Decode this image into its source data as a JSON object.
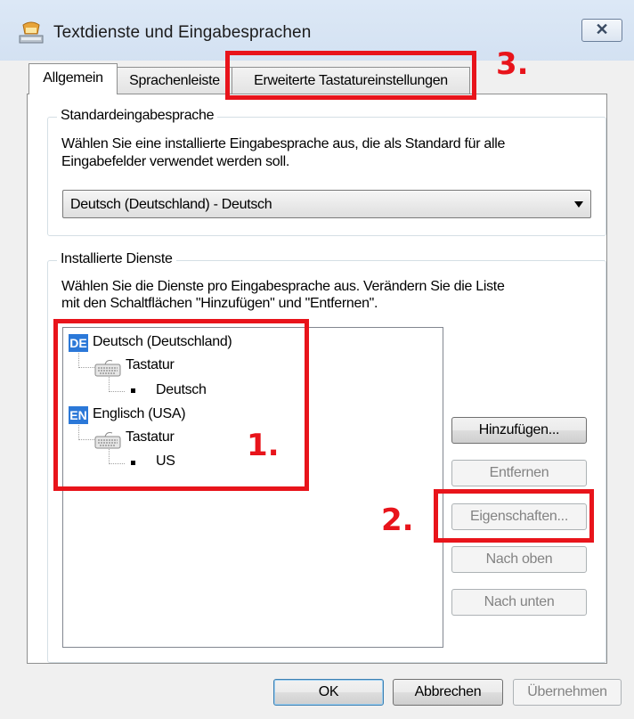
{
  "window": {
    "title": "Textdienste und Eingabesprachen",
    "close_label": "✕"
  },
  "tabs": [
    {
      "label": "Allgemein",
      "active": true
    },
    {
      "label": "Sprachenleiste",
      "active": false
    },
    {
      "label": "Erweiterte Tastatureinstellungen",
      "active": false
    }
  ],
  "default_language": {
    "group_label": "Standardeingabesprache",
    "description_line1": "Wählen Sie eine installierte Eingabesprache aus, die als Standard für alle",
    "description_line2": "Eingabefelder verwendet werden soll.",
    "selected": "Deutsch (Deutschland) - Deutsch"
  },
  "installed_services": {
    "group_label": "Installierte Dienste",
    "description_line1": "Wählen Sie die Dienste pro Eingabesprache aus. Verändern Sie die Liste",
    "description_line2": "mit den Schaltflächen \"Hinzufügen\" und \"Entfernen\".",
    "tree": [
      {
        "badge": "DE",
        "language": "Deutsch (Deutschland)",
        "category": "Tastatur",
        "layout": "Deutsch"
      },
      {
        "badge": "EN",
        "language": "Englisch (USA)",
        "category": "Tastatur",
        "layout": "US"
      }
    ],
    "buttons": {
      "add": "Hinzufügen...",
      "remove": "Entfernen",
      "properties": "Eigenschaften...",
      "move_up": "Nach oben",
      "move_down": "Nach unten"
    }
  },
  "footer": {
    "ok": "OK",
    "cancel": "Abbrechen",
    "apply": "Übernehmen"
  },
  "annotations": {
    "one": "1.",
    "two": "2.",
    "three": "3."
  },
  "colors": {
    "annotation_red": "#e8141b",
    "badge_blue": "#2b78d8"
  }
}
